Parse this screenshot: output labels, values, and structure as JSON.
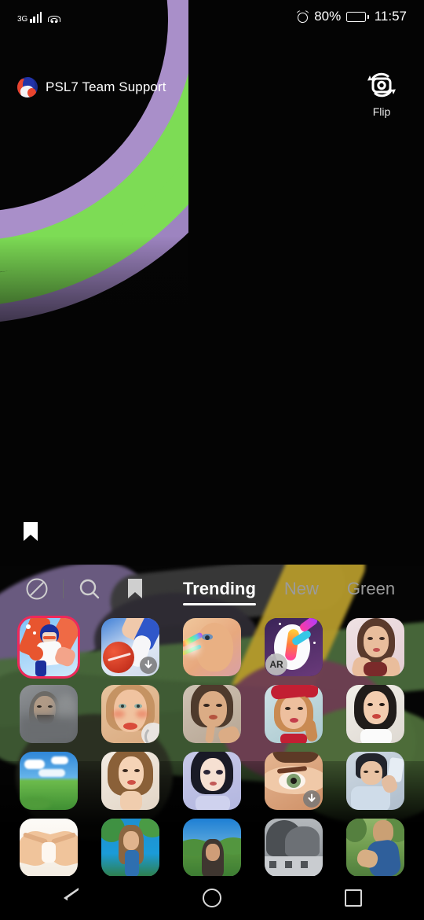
{
  "status_bar": {
    "network_type": "3G",
    "signal_icon": "signal-bars-icon",
    "wifi_icon": "wifi-icon",
    "alarm_icon": "alarm-clock-icon",
    "battery_percent": "80%",
    "battery_icon": "battery-icon",
    "time": "11:57"
  },
  "header": {
    "account_name": "PSL7 Team Support",
    "avatar_icon": "avatar",
    "flip_label": "Flip",
    "flip_icon": "flip-camera-icon"
  },
  "viewport": {
    "saved_icon": "bookmark-icon"
  },
  "effects_panel": {
    "tools": [
      {
        "name": "no-effect-icon",
        "label": "None"
      },
      {
        "name": "search-icon",
        "label": "Search"
      },
      {
        "name": "favorites-icon",
        "label": "Favorites"
      }
    ],
    "tabs": [
      {
        "label": "Trending",
        "active": true
      },
      {
        "label": "New",
        "active": false
      },
      {
        "label": "Green",
        "active": false
      }
    ],
    "accent_color": "#f0285a",
    "grid": [
      [
        {
          "name": "cricket-batsman-effect",
          "selected": true,
          "badge": ""
        },
        {
          "name": "cricket-ball-effect",
          "selected": false,
          "badge": "download"
        },
        {
          "name": "rainbow-face-effect",
          "selected": false,
          "badge": ""
        },
        {
          "name": "ar-paint-effect",
          "selected": false,
          "badge": "ar"
        },
        {
          "name": "portrait-glam-effect",
          "selected": false,
          "badge": ""
        }
      ],
      [
        {
          "name": "smoke-portrait-effect",
          "selected": false,
          "badge": ""
        },
        {
          "name": "blush-beauty-effect",
          "selected": false,
          "badge": "loading"
        },
        {
          "name": "soft-glow-effect",
          "selected": false,
          "badge": ""
        },
        {
          "name": "bandana-retro-effect",
          "selected": false,
          "badge": ""
        },
        {
          "name": "smile-beauty-effect",
          "selected": false,
          "badge": ""
        }
      ],
      [
        {
          "name": "blue-sky-field-effect",
          "selected": false,
          "badge": ""
        },
        {
          "name": "warm-selfie-effect",
          "selected": false,
          "badge": ""
        },
        {
          "name": "anime-portrait-effect",
          "selected": false,
          "badge": ""
        },
        {
          "name": "eye-color-effect",
          "selected": false,
          "badge": "download"
        },
        {
          "name": "mirror-selfie-effect",
          "selected": false,
          "badge": ""
        }
      ],
      [
        {
          "name": "hands-heart-effect",
          "selected": false,
          "badge": ""
        },
        {
          "name": "tropical-scene-effect",
          "selected": false,
          "badge": ""
        },
        {
          "name": "meadow-portrait-effect",
          "selected": false,
          "badge": ""
        },
        {
          "name": "grey-landscape-effect",
          "selected": false,
          "badge": ""
        },
        {
          "name": "painting-scene-effect",
          "selected": false,
          "badge": ""
        }
      ]
    ]
  },
  "nav_bar": {
    "back_icon": "back-triangle-icon",
    "home_icon": "home-circle-icon",
    "recents_icon": "recents-square-icon"
  }
}
